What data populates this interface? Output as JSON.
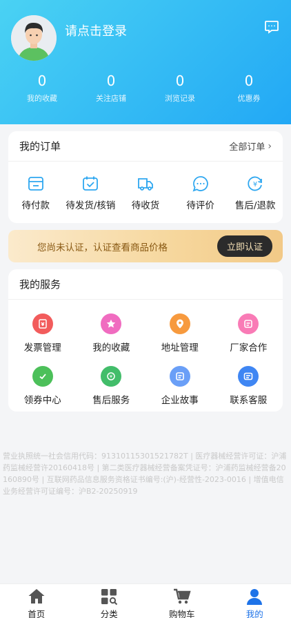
{
  "header": {
    "login_prompt": "请点击登录",
    "stats": [
      {
        "value": "0",
        "label": "我的收藏"
      },
      {
        "value": "0",
        "label": "关注店铺"
      },
      {
        "value": "0",
        "label": "浏览记录"
      },
      {
        "value": "0",
        "label": "优惠券"
      }
    ]
  },
  "orders": {
    "title": "我的订单",
    "all_label": "全部订单",
    "items": [
      {
        "label": "待付款",
        "icon": "wallet-icon"
      },
      {
        "label": "待发货/核销",
        "icon": "calendar-check-icon"
      },
      {
        "label": "待收货",
        "icon": "truck-icon"
      },
      {
        "label": "待评价",
        "icon": "chat-dots-icon"
      },
      {
        "label": "售后/退款",
        "icon": "yen-refresh-icon"
      }
    ]
  },
  "banner": {
    "text": "您尚未认证，认证查看商品价格",
    "button": "立即认证"
  },
  "services": {
    "title": "我的服务",
    "items": [
      {
        "label": "发票管理",
        "icon": "invoice-icon",
        "color": "#f25c5c"
      },
      {
        "label": "我的收藏",
        "icon": "star-icon",
        "color": "#f06cc0"
      },
      {
        "label": "地址管理",
        "icon": "location-pin-icon",
        "color": "#f79a3e"
      },
      {
        "label": "厂家合作",
        "icon": "factory-icon",
        "color": "#f97bb6"
      },
      {
        "label": "领券中心",
        "icon": "coupon-check-icon",
        "color": "#4cc05a"
      },
      {
        "label": "售后服务",
        "icon": "after-sale-icon",
        "color": "#42bd6a"
      },
      {
        "label": "企业故事",
        "icon": "story-icon",
        "color": "#6a9ff7"
      },
      {
        "label": "联系客服",
        "icon": "customer-service-icon",
        "color": "#3f86f3"
      }
    ]
  },
  "license_text": "营业执照统一社会信用代码：91310115301521782T | 医疗器械经营许可证：沪浦药监械经营许20160418号 | 第二类医疗器械经营备案凭证号：沪浦药监械经营备20160890号 | 互联网药品信息服务资格证书编号:(沪)-经营性-2023-0016 | 增值电信业务经营许可证编号：沪B2-20250919",
  "tabbar": {
    "items": [
      {
        "label": "首页",
        "icon": "home-icon",
        "active": false
      },
      {
        "label": "分类",
        "icon": "category-icon",
        "active": false
      },
      {
        "label": "购物车",
        "icon": "cart-icon",
        "active": false
      },
      {
        "label": "我的",
        "icon": "user-icon",
        "active": true
      }
    ]
  },
  "colors": {
    "header_start": "#4ad2f3",
    "header_end": "#22a8f5",
    "accent_blue": "#1e73e8",
    "order_icon": "#2ea7f0"
  }
}
